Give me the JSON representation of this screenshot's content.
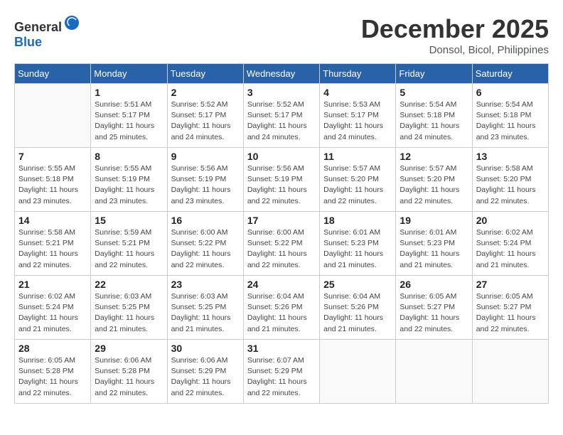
{
  "logo": {
    "text_general": "General",
    "text_blue": "Blue"
  },
  "title": "December 2025",
  "location": "Donsol, Bicol, Philippines",
  "days_of_week": [
    "Sunday",
    "Monday",
    "Tuesday",
    "Wednesday",
    "Thursday",
    "Friday",
    "Saturday"
  ],
  "weeks": [
    [
      {
        "day": "",
        "info": ""
      },
      {
        "day": "1",
        "info": "Sunrise: 5:51 AM\nSunset: 5:17 PM\nDaylight: 11 hours\nand 25 minutes."
      },
      {
        "day": "2",
        "info": "Sunrise: 5:52 AM\nSunset: 5:17 PM\nDaylight: 11 hours\nand 24 minutes."
      },
      {
        "day": "3",
        "info": "Sunrise: 5:52 AM\nSunset: 5:17 PM\nDaylight: 11 hours\nand 24 minutes."
      },
      {
        "day": "4",
        "info": "Sunrise: 5:53 AM\nSunset: 5:17 PM\nDaylight: 11 hours\nand 24 minutes."
      },
      {
        "day": "5",
        "info": "Sunrise: 5:54 AM\nSunset: 5:18 PM\nDaylight: 11 hours\nand 24 minutes."
      },
      {
        "day": "6",
        "info": "Sunrise: 5:54 AM\nSunset: 5:18 PM\nDaylight: 11 hours\nand 23 minutes."
      }
    ],
    [
      {
        "day": "7",
        "info": "Sunrise: 5:55 AM\nSunset: 5:18 PM\nDaylight: 11 hours\nand 23 minutes."
      },
      {
        "day": "8",
        "info": "Sunrise: 5:55 AM\nSunset: 5:19 PM\nDaylight: 11 hours\nand 23 minutes."
      },
      {
        "day": "9",
        "info": "Sunrise: 5:56 AM\nSunset: 5:19 PM\nDaylight: 11 hours\nand 23 minutes."
      },
      {
        "day": "10",
        "info": "Sunrise: 5:56 AM\nSunset: 5:19 PM\nDaylight: 11 hours\nand 22 minutes."
      },
      {
        "day": "11",
        "info": "Sunrise: 5:57 AM\nSunset: 5:20 PM\nDaylight: 11 hours\nand 22 minutes."
      },
      {
        "day": "12",
        "info": "Sunrise: 5:57 AM\nSunset: 5:20 PM\nDaylight: 11 hours\nand 22 minutes."
      },
      {
        "day": "13",
        "info": "Sunrise: 5:58 AM\nSunset: 5:20 PM\nDaylight: 11 hours\nand 22 minutes."
      }
    ],
    [
      {
        "day": "14",
        "info": "Sunrise: 5:58 AM\nSunset: 5:21 PM\nDaylight: 11 hours\nand 22 minutes."
      },
      {
        "day": "15",
        "info": "Sunrise: 5:59 AM\nSunset: 5:21 PM\nDaylight: 11 hours\nand 22 minutes."
      },
      {
        "day": "16",
        "info": "Sunrise: 6:00 AM\nSunset: 5:22 PM\nDaylight: 11 hours\nand 22 minutes."
      },
      {
        "day": "17",
        "info": "Sunrise: 6:00 AM\nSunset: 5:22 PM\nDaylight: 11 hours\nand 22 minutes."
      },
      {
        "day": "18",
        "info": "Sunrise: 6:01 AM\nSunset: 5:23 PM\nDaylight: 11 hours\nand 21 minutes."
      },
      {
        "day": "19",
        "info": "Sunrise: 6:01 AM\nSunset: 5:23 PM\nDaylight: 11 hours\nand 21 minutes."
      },
      {
        "day": "20",
        "info": "Sunrise: 6:02 AM\nSunset: 5:24 PM\nDaylight: 11 hours\nand 21 minutes."
      }
    ],
    [
      {
        "day": "21",
        "info": "Sunrise: 6:02 AM\nSunset: 5:24 PM\nDaylight: 11 hours\nand 21 minutes."
      },
      {
        "day": "22",
        "info": "Sunrise: 6:03 AM\nSunset: 5:25 PM\nDaylight: 11 hours\nand 21 minutes."
      },
      {
        "day": "23",
        "info": "Sunrise: 6:03 AM\nSunset: 5:25 PM\nDaylight: 11 hours\nand 21 minutes."
      },
      {
        "day": "24",
        "info": "Sunrise: 6:04 AM\nSunset: 5:26 PM\nDaylight: 11 hours\nand 21 minutes."
      },
      {
        "day": "25",
        "info": "Sunrise: 6:04 AM\nSunset: 5:26 PM\nDaylight: 11 hours\nand 21 minutes."
      },
      {
        "day": "26",
        "info": "Sunrise: 6:05 AM\nSunset: 5:27 PM\nDaylight: 11 hours\nand 22 minutes."
      },
      {
        "day": "27",
        "info": "Sunrise: 6:05 AM\nSunset: 5:27 PM\nDaylight: 11 hours\nand 22 minutes."
      }
    ],
    [
      {
        "day": "28",
        "info": "Sunrise: 6:05 AM\nSunset: 5:28 PM\nDaylight: 11 hours\nand 22 minutes."
      },
      {
        "day": "29",
        "info": "Sunrise: 6:06 AM\nSunset: 5:28 PM\nDaylight: 11 hours\nand 22 minutes."
      },
      {
        "day": "30",
        "info": "Sunrise: 6:06 AM\nSunset: 5:29 PM\nDaylight: 11 hours\nand 22 minutes."
      },
      {
        "day": "31",
        "info": "Sunrise: 6:07 AM\nSunset: 5:29 PM\nDaylight: 11 hours\nand 22 minutes."
      },
      {
        "day": "",
        "info": ""
      },
      {
        "day": "",
        "info": ""
      },
      {
        "day": "",
        "info": ""
      }
    ]
  ]
}
